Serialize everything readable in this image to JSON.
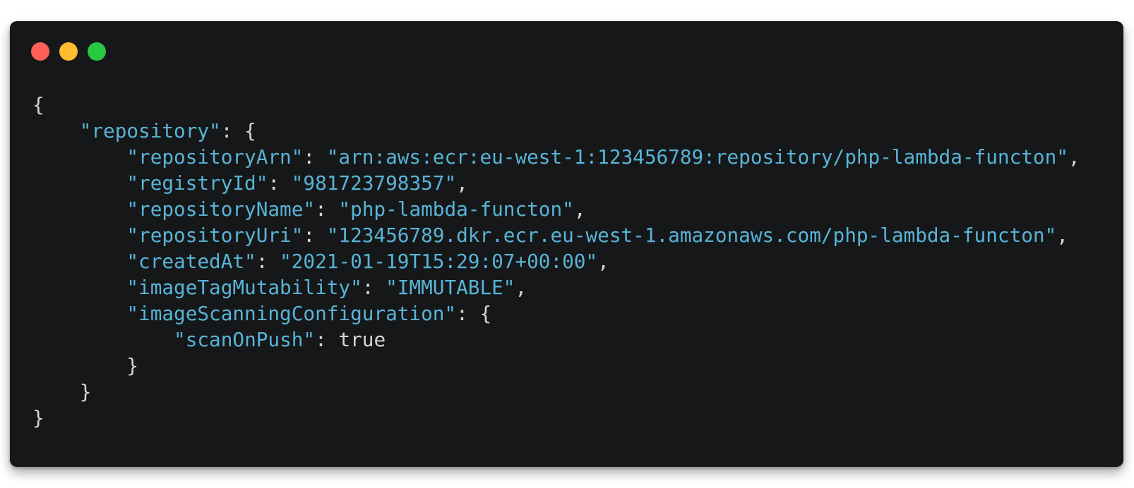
{
  "window": {
    "buttons": [
      {
        "name": "close",
        "color": "#ff5f57"
      },
      {
        "name": "minimize",
        "color": "#febc2e"
      },
      {
        "name": "maximize",
        "color": "#28c840"
      }
    ]
  },
  "colors": {
    "background": "#161719",
    "key": "#58b4d6",
    "string": "#58b4d6",
    "punctuation": "#d6d6d6"
  },
  "code": {
    "open_root": "{",
    "repository_key": "\"repository\"",
    "repository_open": ": {",
    "lines": [
      {
        "key": "\"repositoryArn\"",
        "sep": ": ",
        "value": "\"arn:aws:ecr:eu-west-1:123456789:repository/php-lambda-functon\"",
        "trail": ","
      },
      {
        "key": "\"registryId\"",
        "sep": ": ",
        "value": "\"981723798357\"",
        "trail": ","
      },
      {
        "key": "\"repositoryName\"",
        "sep": ": ",
        "value": "\"php-lambda-functon\"",
        "trail": ","
      },
      {
        "key": "\"repositoryUri\"",
        "sep": ": ",
        "value": "\"123456789.dkr.ecr.eu-west-1.amazonaws.com/php-lambda-functon\"",
        "trail": ","
      },
      {
        "key": "\"createdAt\"",
        "sep": ": ",
        "value": "\"2021-01-19T15:29:07+00:00\"",
        "trail": ","
      },
      {
        "key": "\"imageTagMutability\"",
        "sep": ": ",
        "value": "\"IMMUTABLE\"",
        "trail": ","
      }
    ],
    "scan_config_key": "\"imageScanningConfiguration\"",
    "scan_config_open": ": {",
    "scan_on_push_key": "\"scanOnPush\"",
    "scan_on_push_sep": ": ",
    "scan_on_push_value": "true",
    "scan_config_close": "}",
    "repository_close": "}",
    "close_root": "}"
  }
}
